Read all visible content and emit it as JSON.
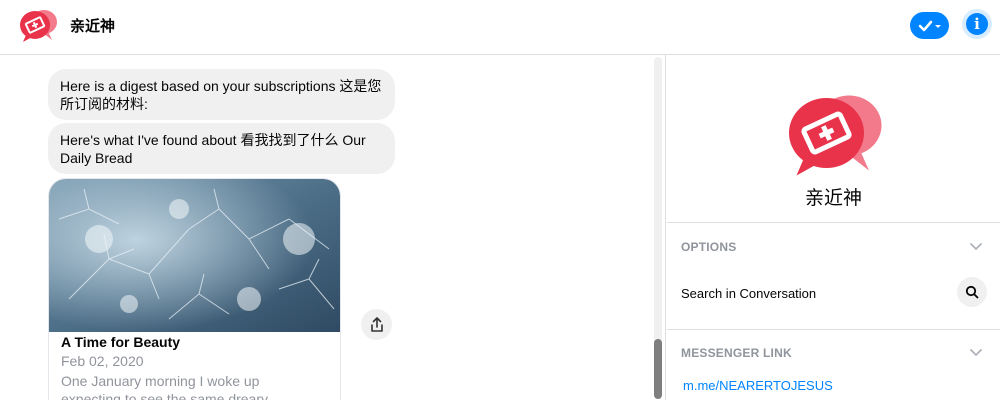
{
  "header": {
    "title": "亲近神",
    "logo_icon": "bible-chat-logo-icon",
    "check_icon": "check-dropdown-icon",
    "info_icon": "info-icon"
  },
  "messages": [
    {
      "text": "Here is a digest based on your subscriptions 这是您所订阅的材料:"
    },
    {
      "text": "Here's what I've found about 看我找到了什么 Our Daily Bread"
    }
  ],
  "card": {
    "title": "A Time for Beauty",
    "date": "Feb 02, 2020",
    "description": "One January morning I woke up expecting to see the same dreary"
  },
  "sidebar": {
    "name": "亲近神",
    "options_label": "OPTIONS",
    "search_label": "Search in Conversation",
    "messenger_link_label": "MESSENGER LINK",
    "messenger_link": "m.me/NEARERTOJESUS"
  },
  "colors": {
    "accent": "#0084ff",
    "logo_red": "#e8334a",
    "logo_pink": "#f27a8a",
    "bubble": "#f1f0f0"
  }
}
